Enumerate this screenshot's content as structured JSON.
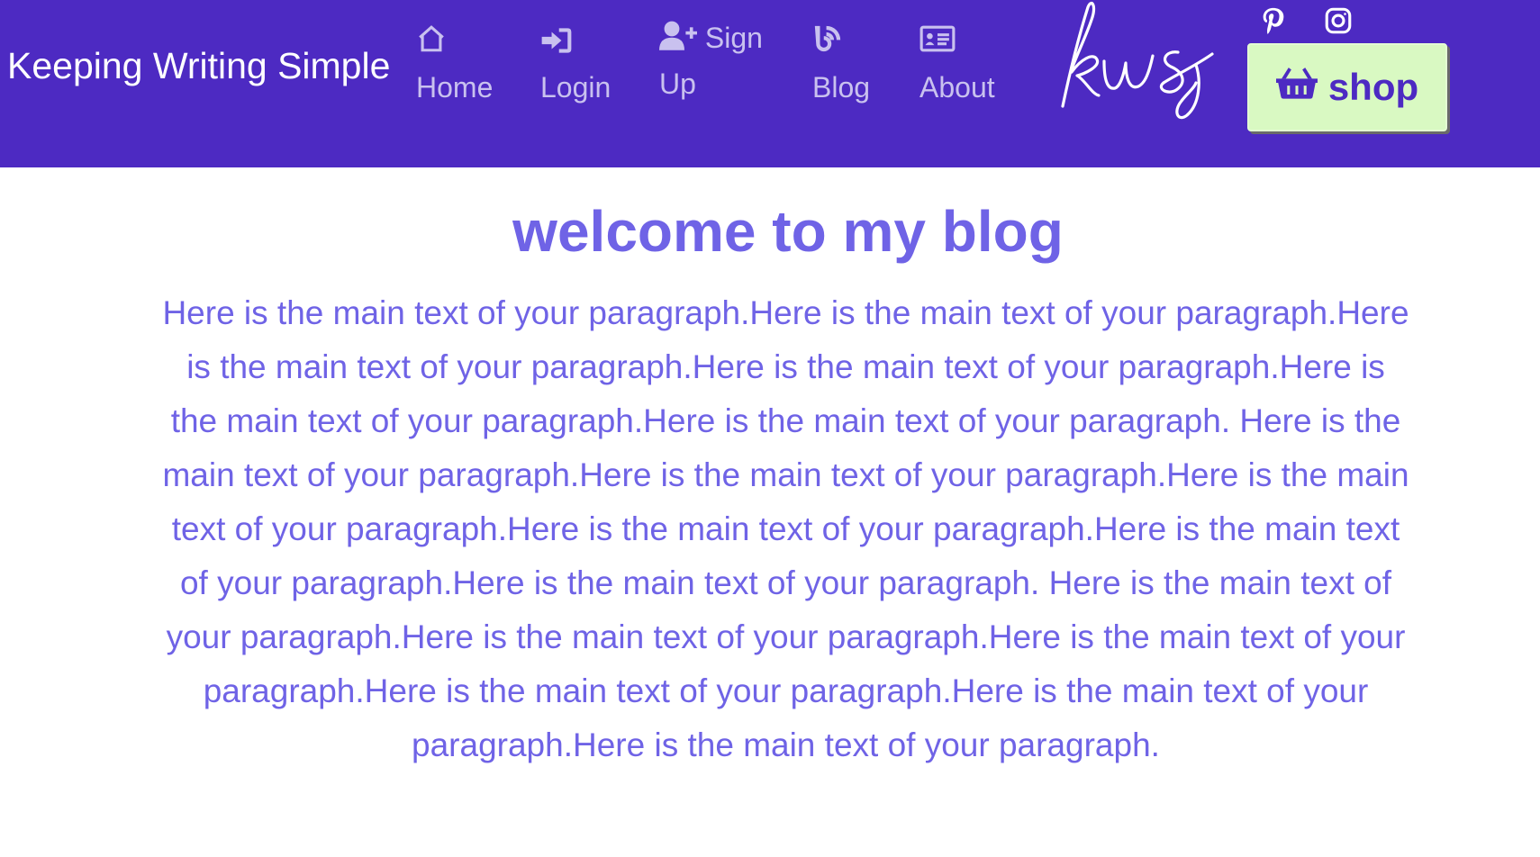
{
  "colors": {
    "navbar_bg": "#4d2ac2",
    "nav_text": "#c9c1ef",
    "brand_text": "#ffffff",
    "shop_bg": "#d9f9c2",
    "shop_text": "#4d2ac2",
    "content_text": "#6f63e6"
  },
  "header": {
    "brand": "Keeping Writing Simple",
    "logo_text": "kws",
    "nav": [
      {
        "label": "Home",
        "icon": "home-icon"
      },
      {
        "label": "Login",
        "icon": "login-icon"
      },
      {
        "label": "Sign",
        "label2": "Up",
        "icon": "user-plus-icon"
      },
      {
        "label": "Blog",
        "icon": "blog-icon"
      },
      {
        "label": "About",
        "icon": "id-card-icon"
      }
    ],
    "social": [
      {
        "icon": "pinterest-icon"
      },
      {
        "icon": "instagram-icon"
      }
    ],
    "shop": {
      "label": "shop",
      "icon": "basket-icon"
    }
  },
  "main": {
    "title": "welcome to my blog",
    "paragraph": "Here is the main text of your paragraph.Here is the main text of your paragraph.Here is the main text of your paragraph.Here is the main text of your paragraph.Here is the main text of your paragraph.Here is the main text of your paragraph. Here is the main text of your paragraph.Here is the main text of your paragraph.Here is the main text of your paragraph.Here is the main text of your paragraph.Here is the main text of your paragraph.Here is the main text of your paragraph. Here is the main text of your paragraph.Here is the main text of your paragraph.Here is the main text of your paragraph.Here is the main text of your paragraph.Here is the main text of your paragraph.Here is the main text of your paragraph."
  }
}
